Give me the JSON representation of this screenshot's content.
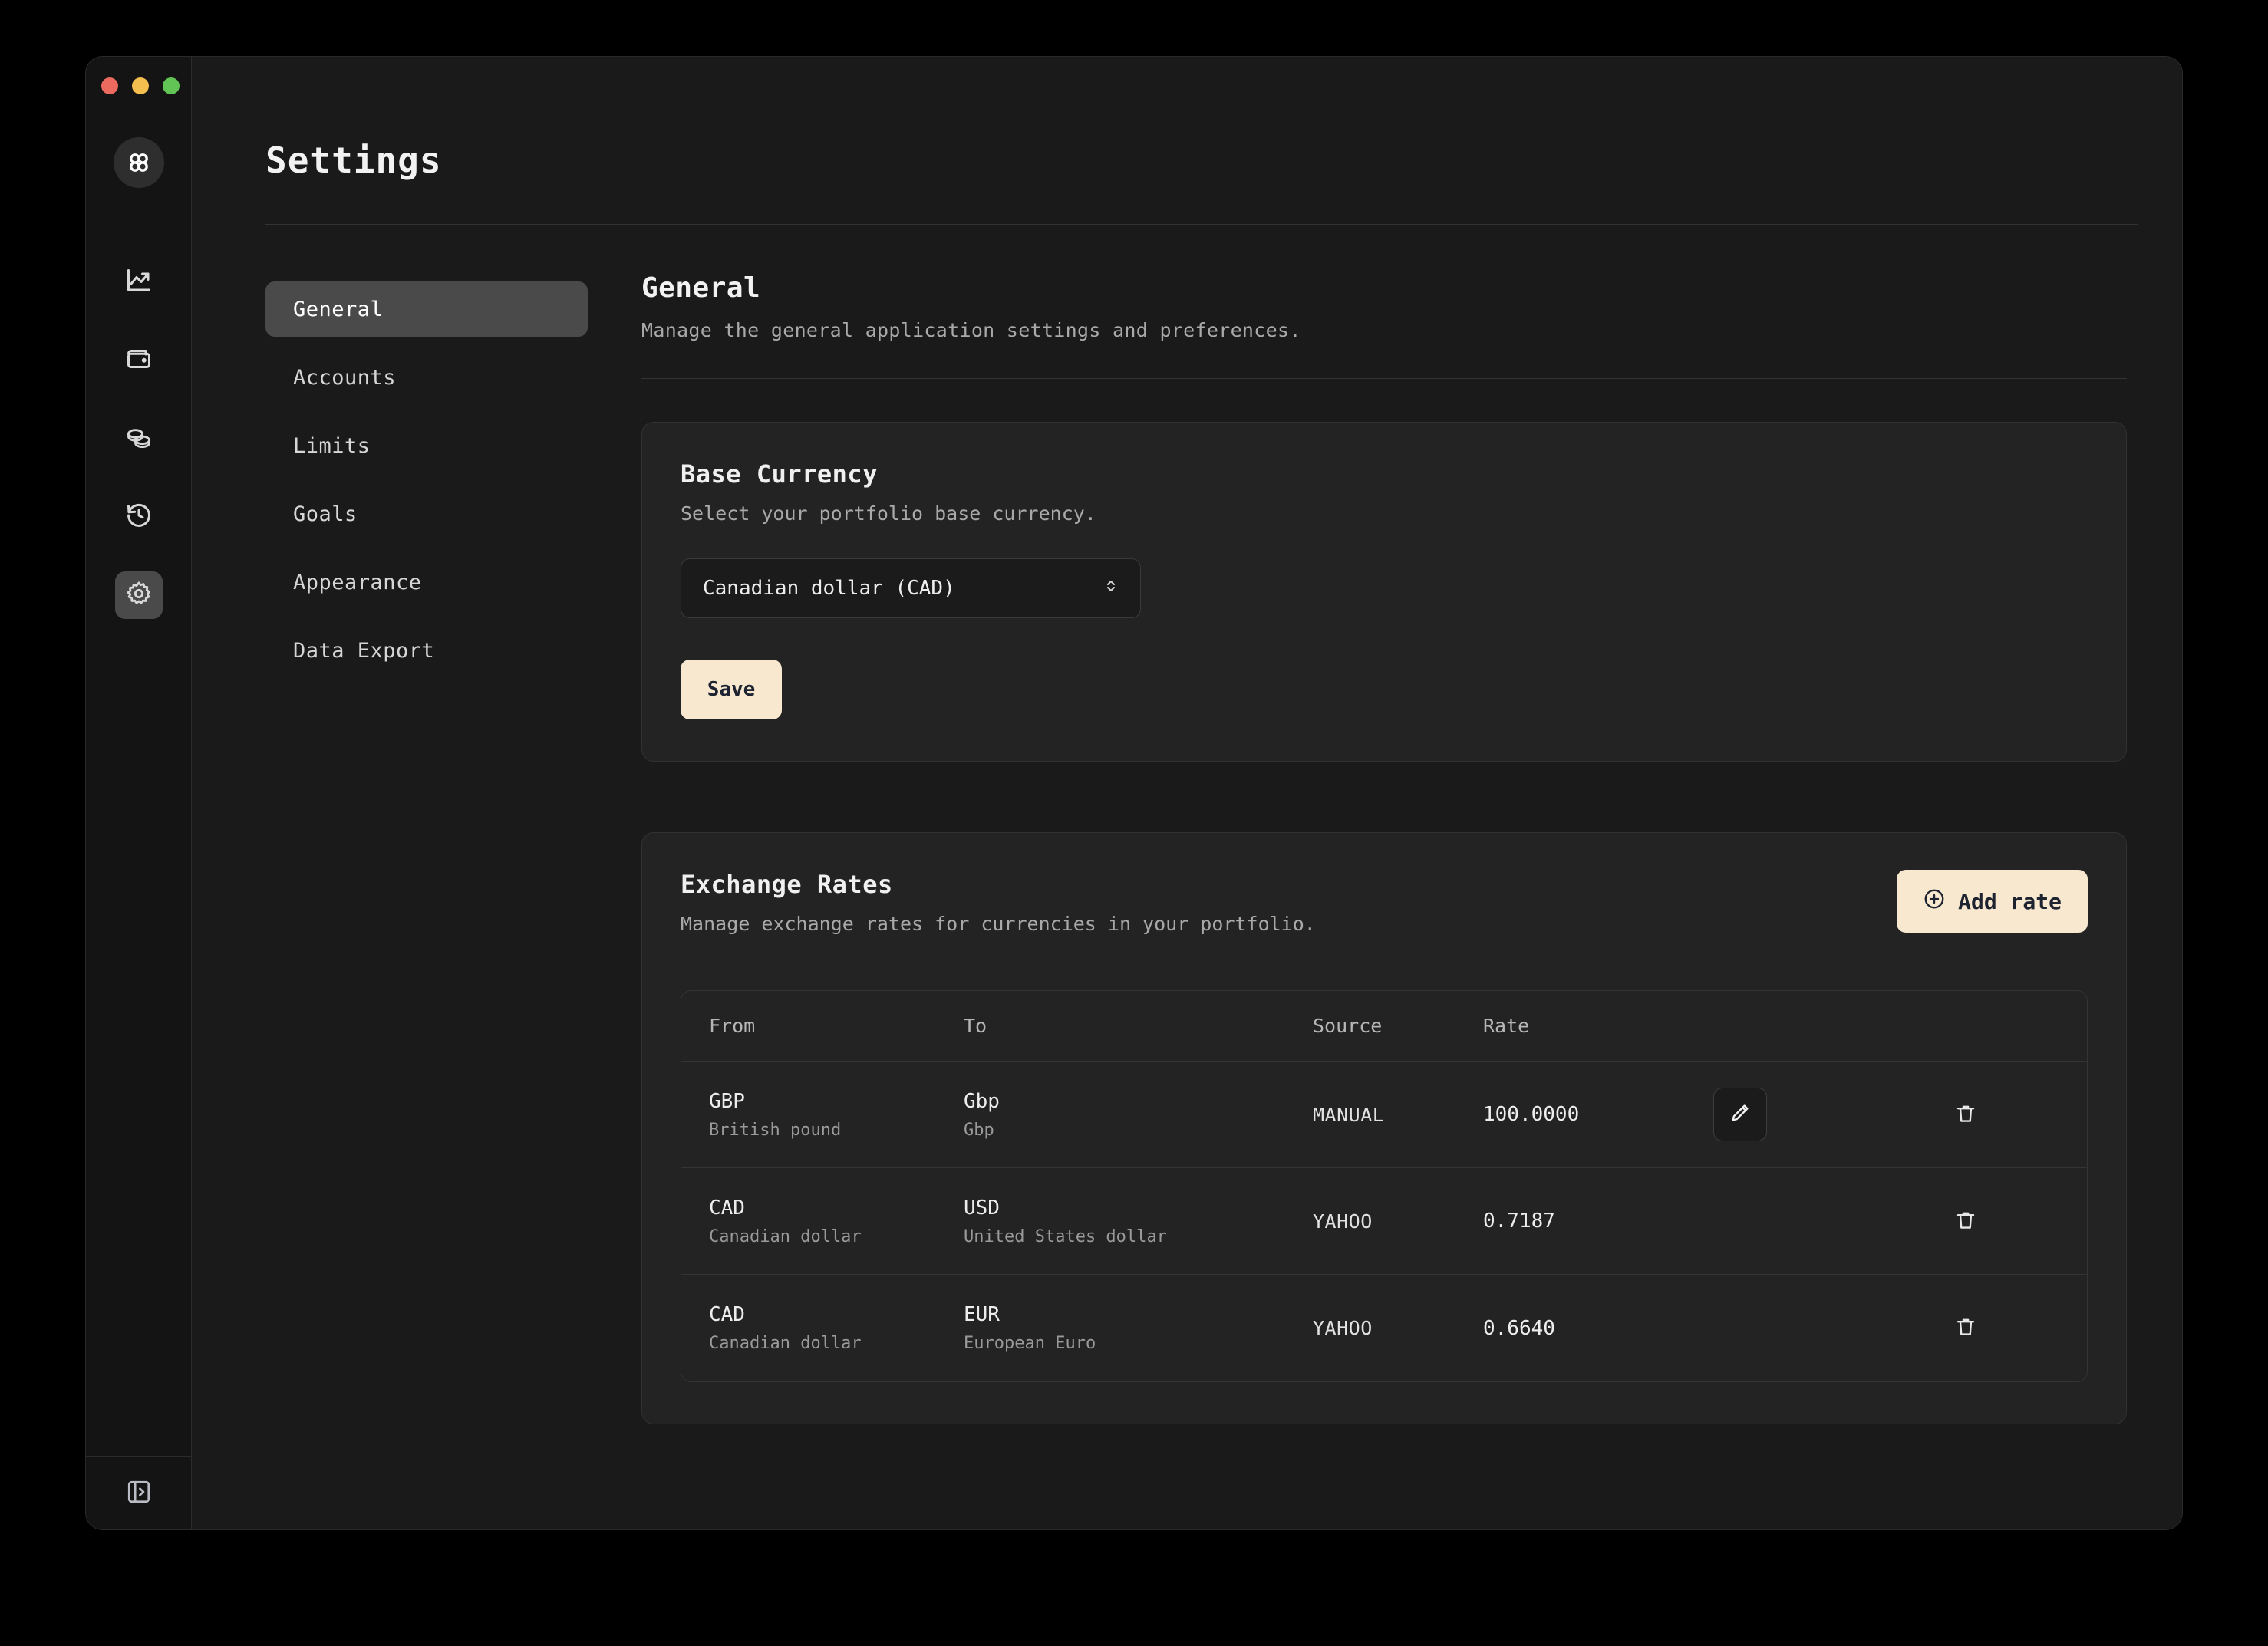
{
  "window": {
    "traffic_lights": [
      "close",
      "minimize",
      "maximize"
    ],
    "logo_icon": "app-rings-logo-icon"
  },
  "rail": {
    "items": [
      {
        "icon": "trending-up-icon",
        "active": false
      },
      {
        "icon": "wallet-icon",
        "active": false
      },
      {
        "icon": "coins-icon",
        "active": false
      },
      {
        "icon": "history-clock-icon",
        "active": false
      },
      {
        "icon": "gear-icon",
        "active": true
      }
    ],
    "bottom_icon": "panel-expand-icon"
  },
  "header": {
    "title": "Settings"
  },
  "nav": {
    "items": [
      {
        "label": "General",
        "active": true
      },
      {
        "label": "Accounts",
        "active": false
      },
      {
        "label": "Limits",
        "active": false
      },
      {
        "label": "Goals",
        "active": false
      },
      {
        "label": "Appearance",
        "active": false
      },
      {
        "label": "Data Export",
        "active": false
      }
    ]
  },
  "general": {
    "heading": "General",
    "description": "Manage the general application settings and preferences."
  },
  "base_currency": {
    "title": "Base Currency",
    "description": "Select your portfolio base currency.",
    "selected": "Canadian dollar (CAD)",
    "chevron_icon": "chevron-up-down-icon",
    "save_label": "Save"
  },
  "exchange_rates": {
    "title": "Exchange Rates",
    "description": "Manage exchange rates for currencies in your portfolio.",
    "add_label": "Add rate",
    "add_icon": "plus-circle-icon",
    "columns": [
      "From",
      "To",
      "Source",
      "Rate"
    ],
    "rows": [
      {
        "from_code": "GBP",
        "from_name": "British pound",
        "to_code": "Gbp",
        "to_name": "Gbp",
        "source": "MANUAL",
        "rate": "100.0000",
        "has_edit": true,
        "edit_icon": "pencil-icon",
        "delete_icon": "trash-icon"
      },
      {
        "from_code": "CAD",
        "from_name": "Canadian dollar",
        "to_code": "USD",
        "to_name": "United States dollar",
        "source": "YAHOO",
        "rate": "0.7187",
        "has_edit": false,
        "edit_icon": "pencil-icon",
        "delete_icon": "trash-icon"
      },
      {
        "from_code": "CAD",
        "from_name": "Canadian dollar",
        "to_code": "EUR",
        "to_name": "European Euro",
        "source": "YAHOO",
        "rate": "0.6640",
        "has_edit": false,
        "edit_icon": "pencil-icon",
        "delete_icon": "trash-icon"
      }
    ]
  },
  "colors": {
    "background": "#000000",
    "window": "#1a1a1a",
    "rail": "#141414",
    "card": "#232323",
    "accent": "#f8e8cf",
    "accent_text": "#1d2330",
    "active_nav": "#4a4a4a",
    "traffic_red": "#ed6a5e",
    "traffic_yellow": "#f4bf4f",
    "traffic_green": "#61c454"
  }
}
